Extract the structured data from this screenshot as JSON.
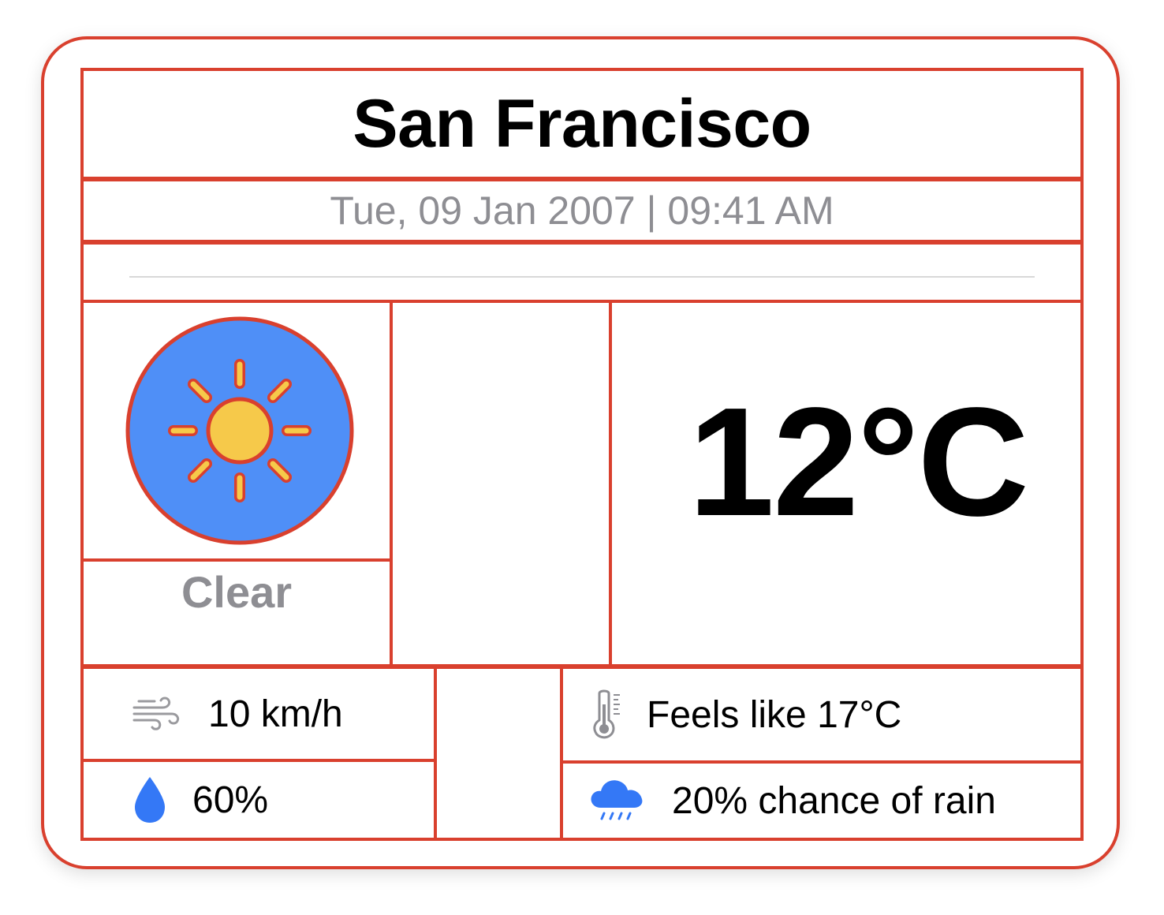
{
  "location": {
    "city": "San Francisco"
  },
  "datetime": "Tue, 09 Jan 2007 | 09:41 AM",
  "current": {
    "icon": "sun-icon",
    "condition": "Clear",
    "temperature": "12°C"
  },
  "details": {
    "wind": {
      "icon": "wind-icon",
      "value": "10 km/h"
    },
    "humidity": {
      "icon": "droplet-icon",
      "value": "60%"
    },
    "feels_like": {
      "icon": "thermometer-icon",
      "value": "Feels like 17°C"
    },
    "rain": {
      "icon": "cloud-rain-icon",
      "value": "20% chance of rain"
    }
  },
  "colors": {
    "outline": "#d9402e",
    "icon_background": "#4f8ff7",
    "sun": "#f6c94a",
    "secondary_text": "#8e8e93",
    "accent_blue": "#3478f6"
  }
}
